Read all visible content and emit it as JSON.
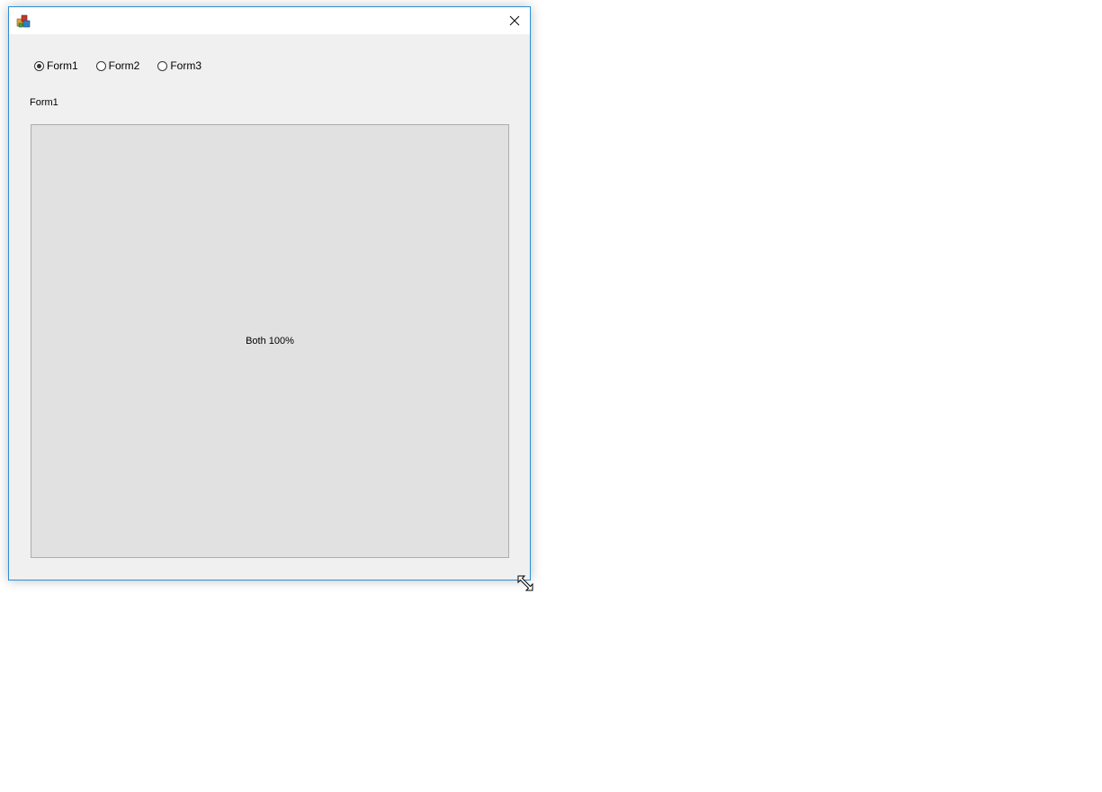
{
  "window": {
    "title": "",
    "close_glyph": "✕"
  },
  "radios": [
    {
      "label": "Form1",
      "checked": true
    },
    {
      "label": "Form2",
      "checked": false
    },
    {
      "label": "Form3",
      "checked": false
    }
  ],
  "form_label": "Form1",
  "panel": {
    "text": "Both 100%"
  },
  "colors": {
    "window_border": "#2b8fd6",
    "window_bg": "#f0f0f0",
    "panel_bg": "#e1e1e1"
  },
  "icons": {
    "app": "app-icon",
    "close": "close-icon",
    "cursor": "resize-diagonal-cursor-icon"
  }
}
